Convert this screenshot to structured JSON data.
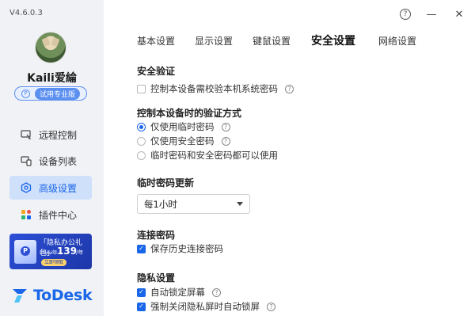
{
  "app": {
    "version": "V4.6.0.3",
    "username": "Kaili爱綸",
    "edition_label": "试用专业版",
    "edition_icon": "P",
    "logo_text": "ToDesk",
    "accent": "#1a66e8"
  },
  "sidebar": {
    "items": [
      {
        "label": "远程控制",
        "icon": "remote-control-icon",
        "active": false
      },
      {
        "label": "设备列表",
        "icon": "device-list-icon",
        "active": false
      },
      {
        "label": "高级设置",
        "icon": "advanced-settings-icon",
        "active": true
      },
      {
        "label": "插件中心",
        "icon": "plugin-center-icon",
        "active": false
      }
    ]
  },
  "promo": {
    "title": "「隐私办公礼包」",
    "old_price": "156/年",
    "price": "139",
    "unit": "/年",
    "cta": "立即领取"
  },
  "window": {
    "help": "?",
    "minimize": "—",
    "close": "✕"
  },
  "tabs": [
    {
      "label": "基本设置",
      "active": false
    },
    {
      "label": "显示设置",
      "active": false
    },
    {
      "label": "键鼠设置",
      "active": false
    },
    {
      "label": "安全设置",
      "active": true
    },
    {
      "label": "网络设置",
      "active": false
    }
  ],
  "security_verify": {
    "title": "安全验证",
    "option": {
      "label": "控制本设备需校验本机系统密码",
      "checked": false
    }
  },
  "verify_method": {
    "title": "控制本设备时的验证方式",
    "options": [
      {
        "label": "仅使用临时密码",
        "checked": true,
        "help": true
      },
      {
        "label": "仅使用安全密码",
        "checked": false,
        "help": true
      },
      {
        "label": "临时密码和安全密码都可以使用",
        "checked": false,
        "help": false
      }
    ]
  },
  "temp_password": {
    "title": "临时密码更新",
    "selected": "每1小时"
  },
  "connection_password": {
    "title": "连接密码",
    "option": {
      "label": "保存历史连接密码",
      "checked": true
    }
  },
  "privacy": {
    "title": "隐私设置",
    "options": [
      {
        "label": "自动锁定屏幕",
        "checked": true,
        "help": true
      },
      {
        "label": "强制关闭隐私屏时自动锁屏",
        "checked": true,
        "help": true
      }
    ]
  }
}
